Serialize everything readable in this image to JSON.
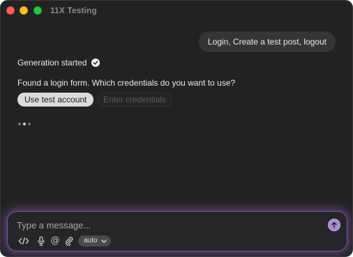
{
  "window": {
    "title": "11X Testing"
  },
  "chat": {
    "user_message": "Login, Create a test post, logout",
    "status_text": "Generation started",
    "assistant_prompt": "Found a login form. Which credentials do you want to use?",
    "options": {
      "primary_label": "Use test account",
      "secondary_label": "Enter credentials"
    },
    "typing_indicator": {
      "dot_count": 3,
      "active_dot": 2
    }
  },
  "composer": {
    "placeholder": "Type a message...",
    "value": "",
    "tools": {
      "code_icon": "code-icon",
      "mic_icon": "microphone-icon",
      "mention_label": "@",
      "attach_icon": "paperclip-icon"
    },
    "mode_selected": "auto",
    "send_icon": "arrow-up-icon"
  },
  "colors": {
    "window_bg": "#222223",
    "bubble_bg": "#353537",
    "accent": "#a98ad6",
    "glow": "#9a5cbe",
    "close": "#ff5f57",
    "minimize": "#febc2e",
    "maximize": "#28c840"
  }
}
